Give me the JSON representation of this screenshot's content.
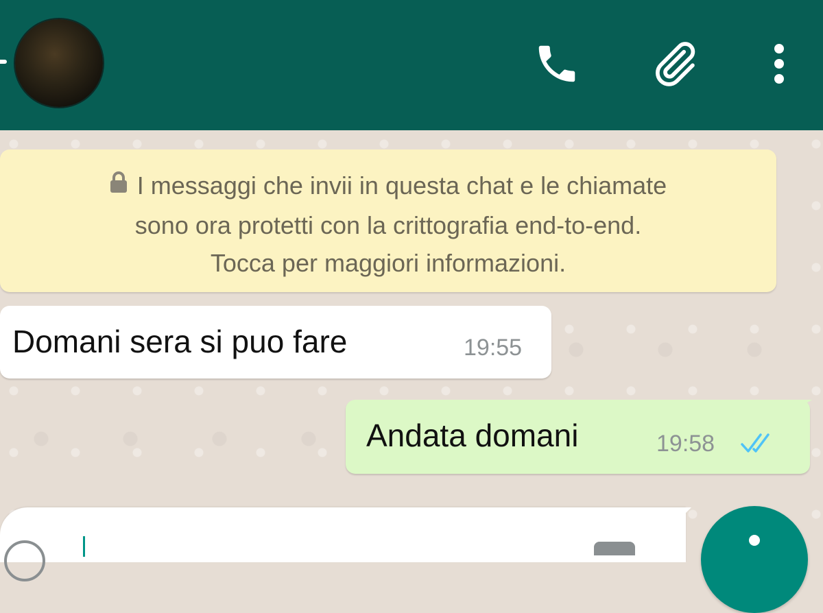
{
  "header": {
    "back_icon": "back-arrow-icon",
    "avatar": "contact-avatar",
    "actions": [
      {
        "name": "call",
        "icon": "phone-icon"
      },
      {
        "name": "attach",
        "icon": "paperclip-icon"
      },
      {
        "name": "menu",
        "icon": "more-vertical-icon"
      }
    ],
    "color": "#075e54"
  },
  "chat": {
    "encryption_notice": {
      "lines": [
        "I messaggi che invii in questa chat e le chiamate",
        "sono ora protetti con la crittografia end-to-end.",
        "Tocca per maggiori informazioni."
      ],
      "icon": "lock-icon",
      "background": "#fcf3c2"
    },
    "messages": [
      {
        "direction": "incoming",
        "text": "Domani sera si puo fare",
        "time": "19:55"
      },
      {
        "direction": "outgoing",
        "text": "Andata domani",
        "time": "19:58",
        "status": "read",
        "status_icon": "double-check-icon",
        "status_color": "#4fc3f7"
      }
    ]
  },
  "input": {
    "emoji_icon": "emoji-icon",
    "camera_icon": "camera-icon",
    "mic_icon": "mic-icon",
    "accent": "#00897b"
  }
}
